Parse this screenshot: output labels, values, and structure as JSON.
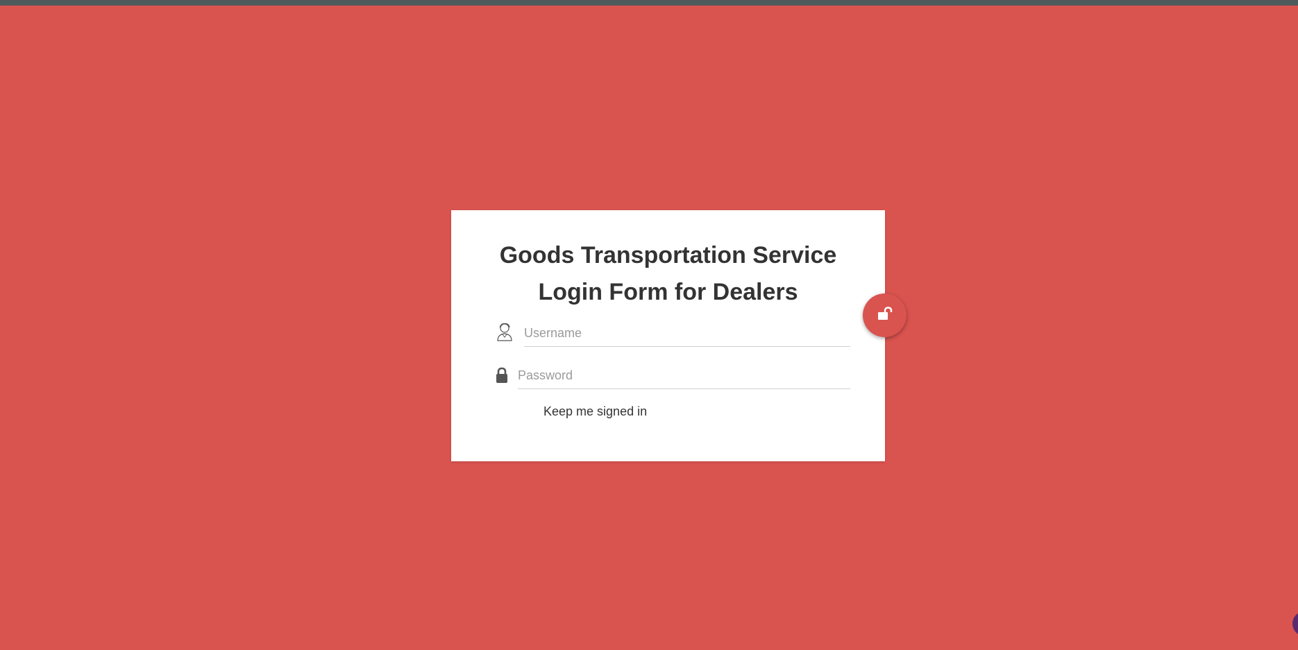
{
  "login_card": {
    "title_line1": "Goods Transportation Service",
    "title_line2": "Login Form for Dealers",
    "username": {
      "placeholder": "Username",
      "value": "",
      "icon": "user-icon"
    },
    "password": {
      "placeholder": "Password",
      "value": "",
      "icon": "lock-icon"
    },
    "keep_signed_in_label": "Keep me signed in"
  },
  "submit": {
    "icon": "unlock-icon"
  },
  "colors": {
    "background": "#d9534f",
    "top_strip": "#4e5a5b",
    "card": "#ffffff",
    "text": "#333333",
    "placeholder": "#9a9a9a",
    "corner_widget": "#5b2a6e"
  }
}
